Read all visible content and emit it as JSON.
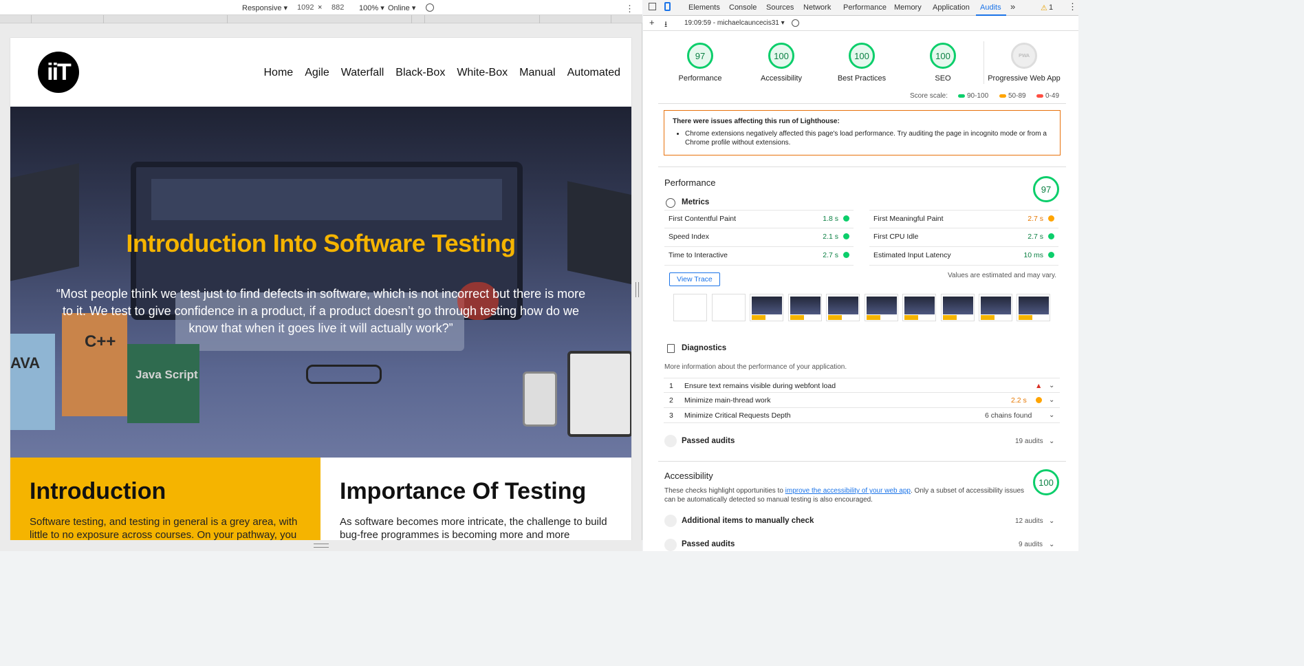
{
  "device_toolbar": {
    "mode": "Responsive",
    "width": "1092",
    "height": "882",
    "zoom": "100%",
    "throttle": "Online"
  },
  "site": {
    "logo_text": "iiT",
    "nav": [
      "Home",
      "Agile",
      "Waterfall",
      "Black-Box",
      "White-Box",
      "Manual",
      "Automated"
    ],
    "hero_title": "Introduction Into Software Testing",
    "hero_quote": "“Most people think we test just to find defects in software, which is not incorrect but there is more to it. We test to give confidence in a product, if a product doesn’t go through testing how do we know that when it goes live it will actually work?”",
    "hero_labels": {
      "cpp": "C++",
      "java": "AVA",
      "js": "Java Script"
    },
    "intro": {
      "title": "Introduction",
      "text": "Software testing, and testing in general is a grey area, with little to no exposure across courses. On your pathway, you"
    },
    "importance": {
      "title": "Importance Of Testing",
      "text": "As software becomes more intricate, the challenge to build bug-free programmes is becoming more and more"
    }
  },
  "devtools": {
    "tabs": [
      "Elements",
      "Console",
      "Sources",
      "Network",
      "Performance",
      "Memory",
      "Application",
      "Audits"
    ],
    "active_tab": "Audits",
    "more_tabs": "»",
    "warning_count": "1",
    "report_label": "19:09:59 - michaelcauncecis31",
    "gauges": [
      {
        "score": "97",
        "label": "Performance"
      },
      {
        "score": "100",
        "label": "Accessibility"
      },
      {
        "score": "100",
        "label": "Best Practices"
      },
      {
        "score": "100",
        "label": "SEO"
      },
      {
        "score": "PWA",
        "label": "Progressive Web App"
      }
    ],
    "score_scale": {
      "label": "Score scale:",
      "good": "90-100",
      "average": "50-89",
      "fail": "0-49"
    },
    "warning": {
      "title": "There were issues affecting this run of Lighthouse:",
      "item": "Chrome extensions negatively affected this page's load performance. Try auditing the page in incognito mode or from a Chrome profile without extensions."
    },
    "performance": {
      "title": "Performance",
      "score": "97",
      "metrics_title": "Metrics",
      "metrics_left": [
        {
          "name": "First Contentful Paint",
          "value": "1.8 s"
        },
        {
          "name": "Speed Index",
          "value": "2.1 s"
        },
        {
          "name": "Time to Interactive",
          "value": "2.7 s"
        }
      ],
      "metrics_right": [
        {
          "name": "First Meaningful Paint",
          "value": "2.7 s"
        },
        {
          "name": "First CPU Idle",
          "value": "2.7 s"
        },
        {
          "name": "Estimated Input Latency",
          "value": "10 ms"
        }
      ],
      "view_trace": "View Trace",
      "estimated_note": "Values are estimated and may vary."
    },
    "diagnostics": {
      "title": "Diagnostics",
      "subtitle": "More information about the performance of your application.",
      "items": [
        {
          "num": "1",
          "text": "Ensure text remains visible during webfont load",
          "value": ""
        },
        {
          "num": "2",
          "text": "Minimize main-thread work",
          "value": "2.2 s"
        },
        {
          "num": "3",
          "text": "Minimize Critical Requests Depth",
          "value": "6 chains found"
        }
      ]
    },
    "passed_perf": {
      "label": "Passed audits",
      "count": "19 audits"
    },
    "accessibility": {
      "title": "Accessibility",
      "score": "100",
      "text_before": "These checks highlight opportunities to",
      "link": "improve the accessibility of your web app",
      "text_after": ". Only a subset of accessibility issues can be automatically detected so manual testing is also encouraged.",
      "manual": {
        "label": "Additional items to manually check",
        "count": "12 audits"
      },
      "passed": {
        "label": "Passed audits",
        "count": "9 audits"
      }
    }
  },
  "colors": {
    "accent": "#f5b400",
    "pass": "#0cce6b",
    "average": "#ffa400",
    "fail": "#ff4e42",
    "link": "#1a73e8"
  }
}
